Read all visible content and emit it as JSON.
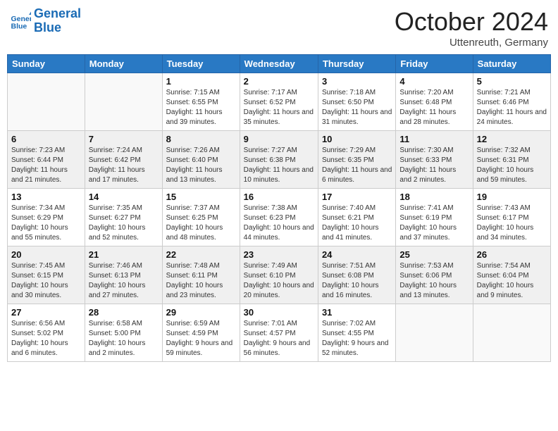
{
  "header": {
    "logo_line1": "General",
    "logo_line2": "Blue",
    "month": "October 2024",
    "location": "Uttenreuth, Germany"
  },
  "weekdays": [
    "Sunday",
    "Monday",
    "Tuesday",
    "Wednesday",
    "Thursday",
    "Friday",
    "Saturday"
  ],
  "weeks": [
    [
      {
        "day": "",
        "info": ""
      },
      {
        "day": "",
        "info": ""
      },
      {
        "day": "1",
        "info": "Sunrise: 7:15 AM\nSunset: 6:55 PM\nDaylight: 11 hours and 39 minutes."
      },
      {
        "day": "2",
        "info": "Sunrise: 7:17 AM\nSunset: 6:52 PM\nDaylight: 11 hours and 35 minutes."
      },
      {
        "day": "3",
        "info": "Sunrise: 7:18 AM\nSunset: 6:50 PM\nDaylight: 11 hours and 31 minutes."
      },
      {
        "day": "4",
        "info": "Sunrise: 7:20 AM\nSunset: 6:48 PM\nDaylight: 11 hours and 28 minutes."
      },
      {
        "day": "5",
        "info": "Sunrise: 7:21 AM\nSunset: 6:46 PM\nDaylight: 11 hours and 24 minutes."
      }
    ],
    [
      {
        "day": "6",
        "info": "Sunrise: 7:23 AM\nSunset: 6:44 PM\nDaylight: 11 hours and 21 minutes."
      },
      {
        "day": "7",
        "info": "Sunrise: 7:24 AM\nSunset: 6:42 PM\nDaylight: 11 hours and 17 minutes."
      },
      {
        "day": "8",
        "info": "Sunrise: 7:26 AM\nSunset: 6:40 PM\nDaylight: 11 hours and 13 minutes."
      },
      {
        "day": "9",
        "info": "Sunrise: 7:27 AM\nSunset: 6:38 PM\nDaylight: 11 hours and 10 minutes."
      },
      {
        "day": "10",
        "info": "Sunrise: 7:29 AM\nSunset: 6:35 PM\nDaylight: 11 hours and 6 minutes."
      },
      {
        "day": "11",
        "info": "Sunrise: 7:30 AM\nSunset: 6:33 PM\nDaylight: 11 hours and 2 minutes."
      },
      {
        "day": "12",
        "info": "Sunrise: 7:32 AM\nSunset: 6:31 PM\nDaylight: 10 hours and 59 minutes."
      }
    ],
    [
      {
        "day": "13",
        "info": "Sunrise: 7:34 AM\nSunset: 6:29 PM\nDaylight: 10 hours and 55 minutes."
      },
      {
        "day": "14",
        "info": "Sunrise: 7:35 AM\nSunset: 6:27 PM\nDaylight: 10 hours and 52 minutes."
      },
      {
        "day": "15",
        "info": "Sunrise: 7:37 AM\nSunset: 6:25 PM\nDaylight: 10 hours and 48 minutes."
      },
      {
        "day": "16",
        "info": "Sunrise: 7:38 AM\nSunset: 6:23 PM\nDaylight: 10 hours and 44 minutes."
      },
      {
        "day": "17",
        "info": "Sunrise: 7:40 AM\nSunset: 6:21 PM\nDaylight: 10 hours and 41 minutes."
      },
      {
        "day": "18",
        "info": "Sunrise: 7:41 AM\nSunset: 6:19 PM\nDaylight: 10 hours and 37 minutes."
      },
      {
        "day": "19",
        "info": "Sunrise: 7:43 AM\nSunset: 6:17 PM\nDaylight: 10 hours and 34 minutes."
      }
    ],
    [
      {
        "day": "20",
        "info": "Sunrise: 7:45 AM\nSunset: 6:15 PM\nDaylight: 10 hours and 30 minutes."
      },
      {
        "day": "21",
        "info": "Sunrise: 7:46 AM\nSunset: 6:13 PM\nDaylight: 10 hours and 27 minutes."
      },
      {
        "day": "22",
        "info": "Sunrise: 7:48 AM\nSunset: 6:11 PM\nDaylight: 10 hours and 23 minutes."
      },
      {
        "day": "23",
        "info": "Sunrise: 7:49 AM\nSunset: 6:10 PM\nDaylight: 10 hours and 20 minutes."
      },
      {
        "day": "24",
        "info": "Sunrise: 7:51 AM\nSunset: 6:08 PM\nDaylight: 10 hours and 16 minutes."
      },
      {
        "day": "25",
        "info": "Sunrise: 7:53 AM\nSunset: 6:06 PM\nDaylight: 10 hours and 13 minutes."
      },
      {
        "day": "26",
        "info": "Sunrise: 7:54 AM\nSunset: 6:04 PM\nDaylight: 10 hours and 9 minutes."
      }
    ],
    [
      {
        "day": "27",
        "info": "Sunrise: 6:56 AM\nSunset: 5:02 PM\nDaylight: 10 hours and 6 minutes."
      },
      {
        "day": "28",
        "info": "Sunrise: 6:58 AM\nSunset: 5:00 PM\nDaylight: 10 hours and 2 minutes."
      },
      {
        "day": "29",
        "info": "Sunrise: 6:59 AM\nSunset: 4:59 PM\nDaylight: 9 hours and 59 minutes."
      },
      {
        "day": "30",
        "info": "Sunrise: 7:01 AM\nSunset: 4:57 PM\nDaylight: 9 hours and 56 minutes."
      },
      {
        "day": "31",
        "info": "Sunrise: 7:02 AM\nSunset: 4:55 PM\nDaylight: 9 hours and 52 minutes."
      },
      {
        "day": "",
        "info": ""
      },
      {
        "day": "",
        "info": ""
      }
    ]
  ]
}
